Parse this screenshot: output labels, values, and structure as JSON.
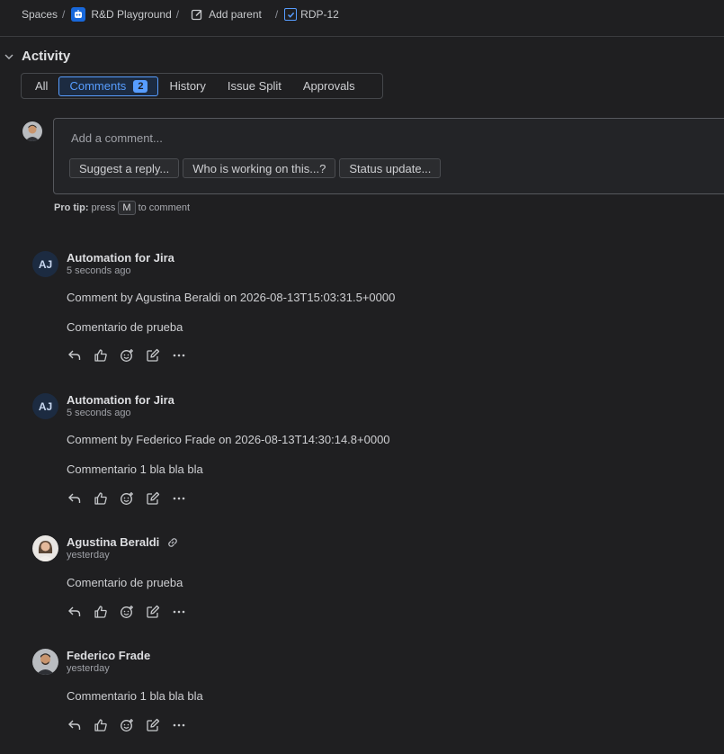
{
  "breadcrumb": {
    "spaces": "Spaces",
    "project": "R&D Playground",
    "add_parent": "Add parent",
    "issue_key": "RDP-12",
    "separator": "/"
  },
  "activity": {
    "title": "Activity",
    "tabs": [
      {
        "label": "All"
      },
      {
        "label": "Comments",
        "count": "2"
      },
      {
        "label": "History"
      },
      {
        "label": "Issue Split"
      },
      {
        "label": "Approvals"
      }
    ]
  },
  "composer": {
    "placeholder": "Add a comment...",
    "quick_replies": [
      "Suggest a reply...",
      "Who is working on this...?",
      "Status update..."
    ],
    "pro_tip_label": "Pro tip:",
    "pro_tip_press": "press",
    "pro_tip_key": "M",
    "pro_tip_suffix": "to comment"
  },
  "comments": [
    {
      "author": "Automation for Jira",
      "initials": "AJ",
      "time": "5 seconds ago",
      "lines": [
        "Comment by Agustina Beraldi on 2026-08-13T15:03:31.5+0000",
        "Comentario de prueba"
      ]
    },
    {
      "author": "Automation for Jira",
      "initials": "AJ",
      "time": "5 seconds ago",
      "lines": [
        "Comment by Federico Frade on 2026-08-13T14:30:14.8+0000",
        "Commentario 1 bla bla bla"
      ]
    },
    {
      "author": "Agustina Beraldi",
      "time": "yesterday",
      "lines": [
        "Comentario de prueba"
      ]
    },
    {
      "author": "Federico Frade",
      "time": "yesterday",
      "lines": [
        "Commentario 1 bla bla bla"
      ]
    }
  ],
  "icons": {
    "reply": "reply-icon",
    "like": "thumbs-up-icon",
    "emoji": "add-reaction-icon",
    "edit": "edit-icon",
    "more": "more-icon",
    "permalink": "link-icon"
  },
  "colors": {
    "background": "#1f1f21",
    "accent": "#579dff",
    "brand_blue": "#1868db"
  }
}
